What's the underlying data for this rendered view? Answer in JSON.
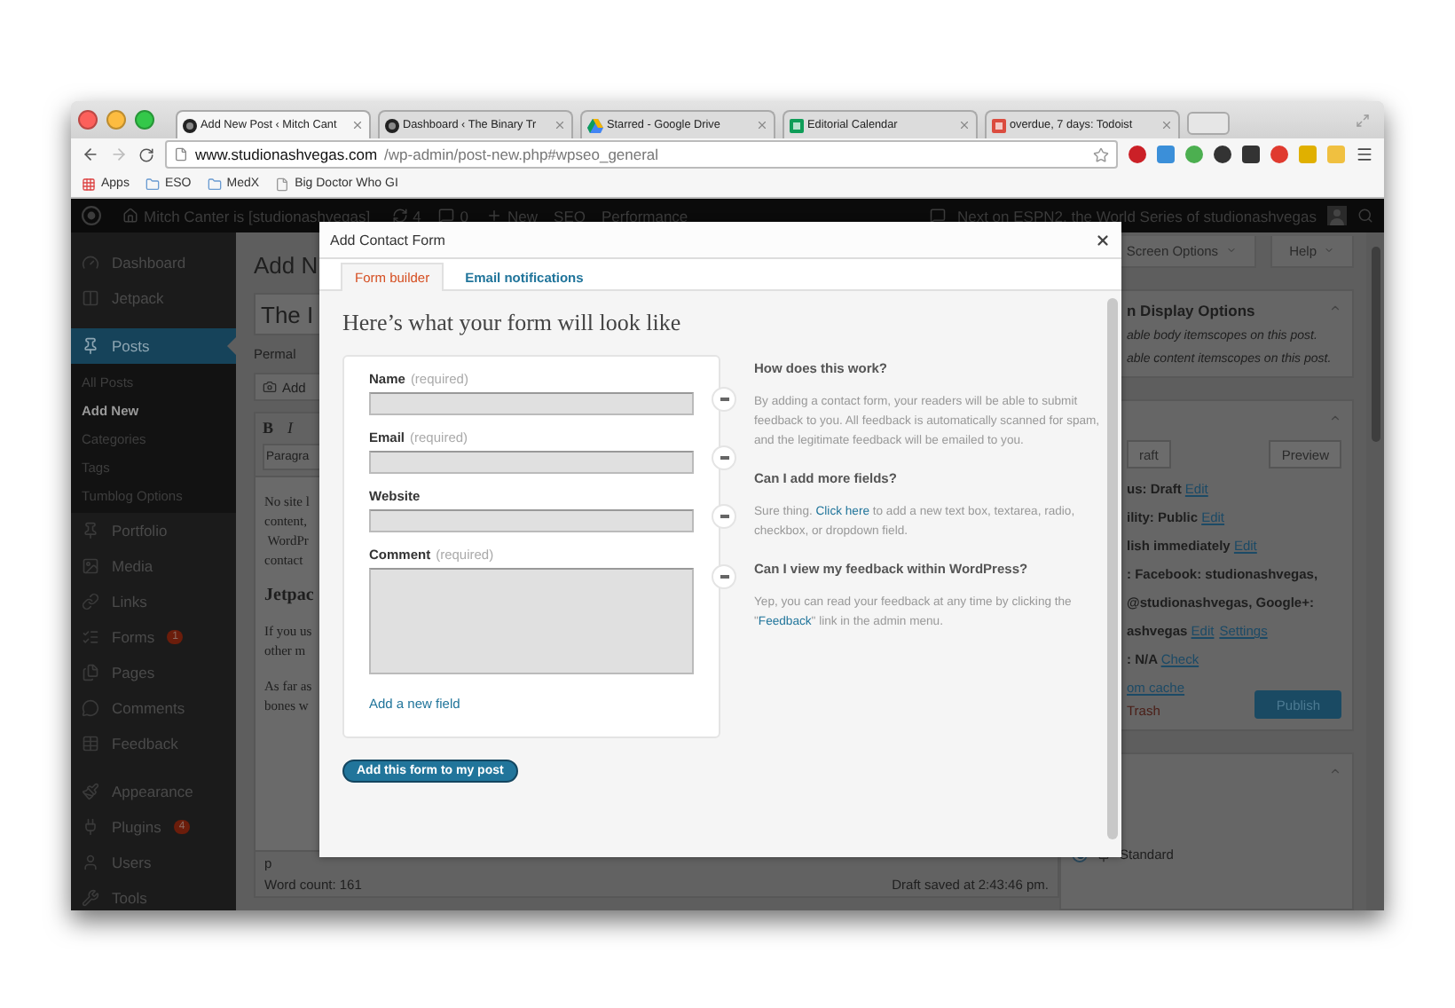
{
  "browser": {
    "tabs": [
      {
        "title": "Add New Post ‹ Mitch Cant",
        "selected": true
      },
      {
        "title": "Dashboard ‹ The Binary Tr",
        "selected": false
      },
      {
        "title": "Starred - Google Drive",
        "selected": false
      },
      {
        "title": "Editorial Calendar",
        "selected": false
      },
      {
        "title": "overdue, 7 days: Todoist",
        "selected": false
      }
    ],
    "url": {
      "host": "www.studionashvegas.com",
      "path": "/wp-admin/post-new.php#wpseo_general"
    },
    "bookmarks": [
      {
        "label": "Apps",
        "kind": "apps"
      },
      {
        "label": "ESO",
        "kind": "folder"
      },
      {
        "label": "MedX",
        "kind": "folder"
      },
      {
        "label": "Big Doctor Who GI",
        "kind": "page"
      }
    ]
  },
  "admin_bar": {
    "site": "Mitch Canter is [studionashvegas]",
    "updates": "4",
    "comments": "0",
    "new": "New",
    "items": [
      "SEO",
      "Performance"
    ],
    "notice": "Next on ESPN2, the World Series of studionashvegas"
  },
  "sidebar": {
    "groups": [
      {
        "items": [
          {
            "label": "Dashboard",
            "selected": false
          },
          {
            "label": "Jetpack",
            "selected": false
          }
        ]
      },
      {
        "items": [
          {
            "label": "Posts",
            "selected": true,
            "children": [
              {
                "label": "All Posts",
                "selected": false
              },
              {
                "label": "Add New",
                "selected": true
              },
              {
                "label": "Categories",
                "selected": false
              },
              {
                "label": "Tags",
                "selected": false
              },
              {
                "label": "Tumblog Options",
                "selected": false
              }
            ]
          },
          {
            "label": "Portfolio",
            "selected": false
          },
          {
            "label": "Media",
            "selected": false
          },
          {
            "label": "Links",
            "selected": false
          },
          {
            "label": "Forms",
            "selected": false,
            "badge": "1"
          },
          {
            "label": "Pages",
            "selected": false
          },
          {
            "label": "Comments",
            "selected": false
          },
          {
            "label": "Feedback",
            "selected": false
          }
        ]
      },
      {
        "items": [
          {
            "label": "Appearance",
            "selected": false
          },
          {
            "label": "Plugins",
            "selected": false,
            "badge": "4"
          },
          {
            "label": "Users",
            "selected": false
          },
          {
            "label": "Tools",
            "selected": false
          }
        ]
      }
    ]
  },
  "editor": {
    "title": "Add N",
    "post_title": "The I",
    "permalink": "Permal",
    "add_media": "Add",
    "format_buttons": [
      "B",
      "I"
    ],
    "format_select": "Paragra",
    "paragraphs": [
      {
        "kind": "text",
        "lines": [
          "No site l",
          "content,",
          " WordPr",
          "contact"
        ]
      },
      {
        "kind": "heading",
        "lines": [
          "Jetpac"
        ]
      },
      {
        "kind": "text",
        "lines": [
          "If you us",
          "other m"
        ]
      },
      {
        "kind": "text",
        "lines": [
          "As far as",
          "bones w"
        ]
      }
    ],
    "path": "p",
    "word_count": "Word count: 161",
    "draft_saved": "Draft saved at 2:43:46 pm."
  },
  "side": {
    "screen_options": "Screen Options",
    "help": "Help",
    "display_panel": {
      "title": "n Display Options",
      "notes": [
        "able body itemscopes on this post.",
        "able content itemscopes on this post."
      ]
    },
    "publish_panel": {
      "save_draft": "raft",
      "preview": "Preview",
      "rows": [
        {
          "parts": [
            {
              "text": "us: Draft "
            },
            {
              "text": "Edit",
              "link": true
            }
          ]
        },
        {
          "parts": [
            {
              "text": "ility: Public "
            },
            {
              "text": "Edit",
              "link": true
            }
          ]
        },
        {
          "parts": [
            {
              "text": "lish immediately "
            },
            {
              "text": "Edit",
              "link": true
            }
          ]
        },
        {
          "parts": [
            {
              "text": ": Facebook: studionashvegas,"
            }
          ]
        },
        {
          "parts": [
            {
              "text": "@studionashvegas, Google+:"
            }
          ]
        },
        {
          "parts": [
            {
              "text": "ashvegas "
            },
            {
              "text": "Edit",
              "link": true
            },
            {
              "text": "Settings",
              "link": true
            }
          ]
        },
        {
          "parts": [
            {
              "text": ": N/A "
            },
            {
              "text": "Check",
              "link": true
            }
          ]
        }
      ],
      "cache_link": "om cache",
      "trash": "Trash",
      "publish": "Publish"
    },
    "format_panel": {
      "options": [
        {
          "label": "Standard",
          "selected": true
        }
      ]
    }
  },
  "modal": {
    "title": "Add Contact Form",
    "tabs": [
      {
        "label": "Form builder",
        "selected": true
      },
      {
        "label": "Email notifications",
        "selected": false
      }
    ],
    "heading": "Here’s what your form will look like",
    "fields": [
      {
        "label": "Name",
        "note": "(required)",
        "kind": "input"
      },
      {
        "label": "Email",
        "note": "(required)",
        "kind": "input"
      },
      {
        "label": "Website",
        "kind": "input"
      },
      {
        "label": "Comment",
        "note": "(required)",
        "kind": "textarea"
      }
    ],
    "add_field": "Add a new field",
    "submit": "Add this form to my post",
    "help": [
      {
        "question": "How does this work?",
        "answer": [
          {
            "text": "By adding a contact form, your readers will be able to submit feedback to you. All feedback is automatically scanned for spam, and the legitimate feedback will be emailed to you."
          }
        ]
      },
      {
        "question": "Can I add more fields?",
        "answer": [
          {
            "text": "Sure thing. "
          },
          {
            "text": "Click here",
            "link": true
          },
          {
            "text": " to add a new text box, textarea, radio, checkbox, or dropdown field."
          }
        ]
      },
      {
        "question": "Can I view my feedback within WordPress?",
        "answer": [
          {
            "text": "Yep, you can read your feedback at any time by clicking the \""
          },
          {
            "text": "Feedback",
            "link": true
          },
          {
            "text": "\" link in the admin menu."
          }
        ]
      }
    ]
  }
}
